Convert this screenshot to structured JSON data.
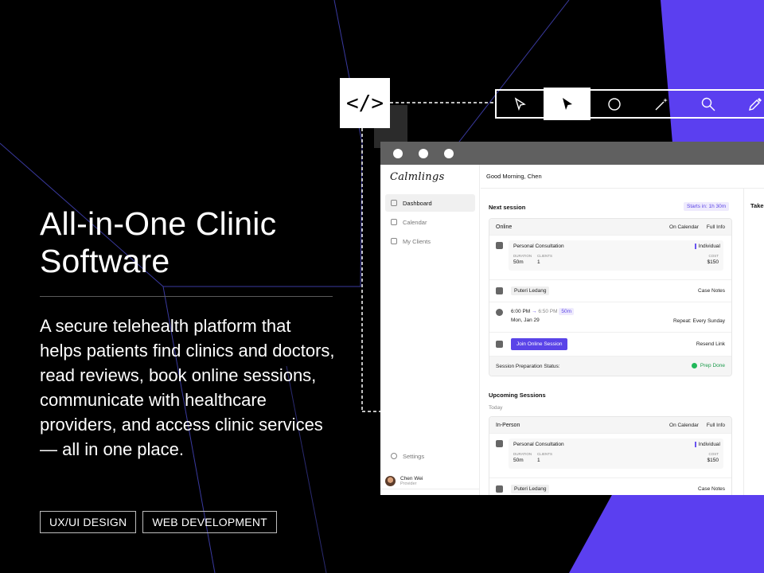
{
  "hero": {
    "title_line1": "All-in-One Clinic",
    "title_line2": "Software",
    "description": "A secure telehealth platform that helps patients find clinics and doctors, read reviews, book online sessions, communicate with healthcare providers, and access clinic services — all in one place.",
    "tags": [
      "UX/UI DESIGN",
      "WEB DEVELOPMENT"
    ]
  },
  "code_icon": "</>",
  "toolbar": {
    "tools": [
      "pointer-outline-icon",
      "pointer-filled-icon",
      "circle-icon",
      "magic-wand-icon",
      "search-icon",
      "eyedropper-icon"
    ],
    "active_index": 1
  },
  "colors": {
    "accent": "#5a44e8",
    "bg": "#000000",
    "purple_shape": "#5b3ff0"
  },
  "app": {
    "logo": "Calmlings",
    "greeting": "Good Morning, Chen",
    "nav": [
      "Dashboard",
      "Calendar",
      "My Clients"
    ],
    "settings": "Settings",
    "user": {
      "name": "Chen Wei",
      "role": "Provider"
    },
    "next_session": {
      "title": "Next session",
      "starts_in": "Starts in: 1h 30m",
      "mode": "Online",
      "on_calendar": "On Calendar",
      "full_info": "Full Info",
      "consult_title": "Personal Consultation",
      "type": "Individual",
      "duration_label": "DURATION",
      "duration": "50m",
      "clients_label": "CLIENTS",
      "clients": "1",
      "cost_label": "COST",
      "cost": "$150",
      "client_name": "Puteri Ledang",
      "case_notes": "Case Notes",
      "start_time": "6:00 PM",
      "end_time": "6:50 PM",
      "length": "50m",
      "date": "Mon, Jan 29",
      "repeat": "Repeat: Every Sunday",
      "join": "Join Online Session",
      "resend": "Resend Link",
      "prep_label": "Session Preparation Status:",
      "prep_status": "Prep Done"
    },
    "upcoming": {
      "title": "Upcoming Sessions",
      "day": "Today",
      "mode": "In-Person",
      "on_calendar": "On Calendar",
      "full_info": "Full Info",
      "consult_title": "Personal Consultation",
      "type": "Individual",
      "duration_label": "DURATION",
      "duration": "50m",
      "clients_label": "CLIENTS",
      "clients": "1",
      "cost_label": "COST",
      "cost": "$150",
      "client_name": "Puteri Ledang",
      "case_notes": "Case Notes"
    },
    "right_pane_title": "Take"
  }
}
